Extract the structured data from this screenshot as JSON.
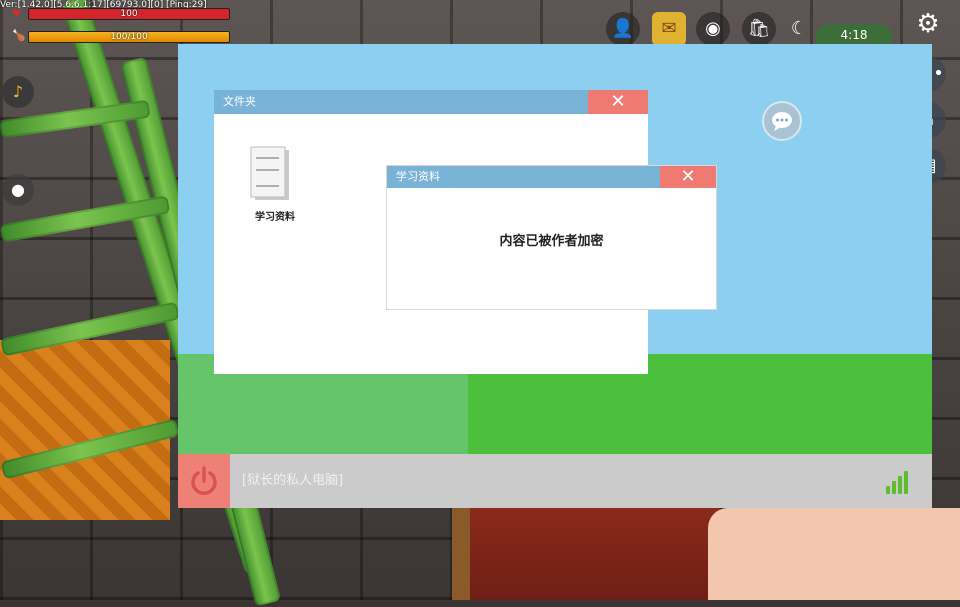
{
  "hud": {
    "version_text": "Ver:[1.42.0][5.6.6.1:17][69793.0][0] [Ping:29]",
    "health_label": "100",
    "health_value": 100,
    "hunger_label": "100/100",
    "hunger_value": 100,
    "clock": "4:18",
    "icons": [
      "add-friend-icon",
      "mail-icon",
      "camera-icon",
      "shop-bag-icon",
      "moon-icon",
      "settings-icon",
      "more-icon",
      "home-icon",
      "backpack-icon",
      "music-icon",
      "record-icon"
    ]
  },
  "computer": {
    "folder_window": {
      "title": "文件夹",
      "close_symbol": "✕",
      "file_label": "学习资料"
    },
    "doc_window": {
      "title": "学习资料",
      "close_symbol": "✕",
      "message": "内容已被作者加密"
    },
    "taskbar": {
      "title": "[狱长的私人电脑]",
      "signal_bars": 4
    }
  },
  "colors": {
    "sky": "#8dcff0",
    "grass": "#4cbf3c",
    "title_bar": "#78b2d5",
    "close_button": "#ef7a72",
    "power_button": "#ee8078",
    "taskbar": "#cbcbcb"
  }
}
